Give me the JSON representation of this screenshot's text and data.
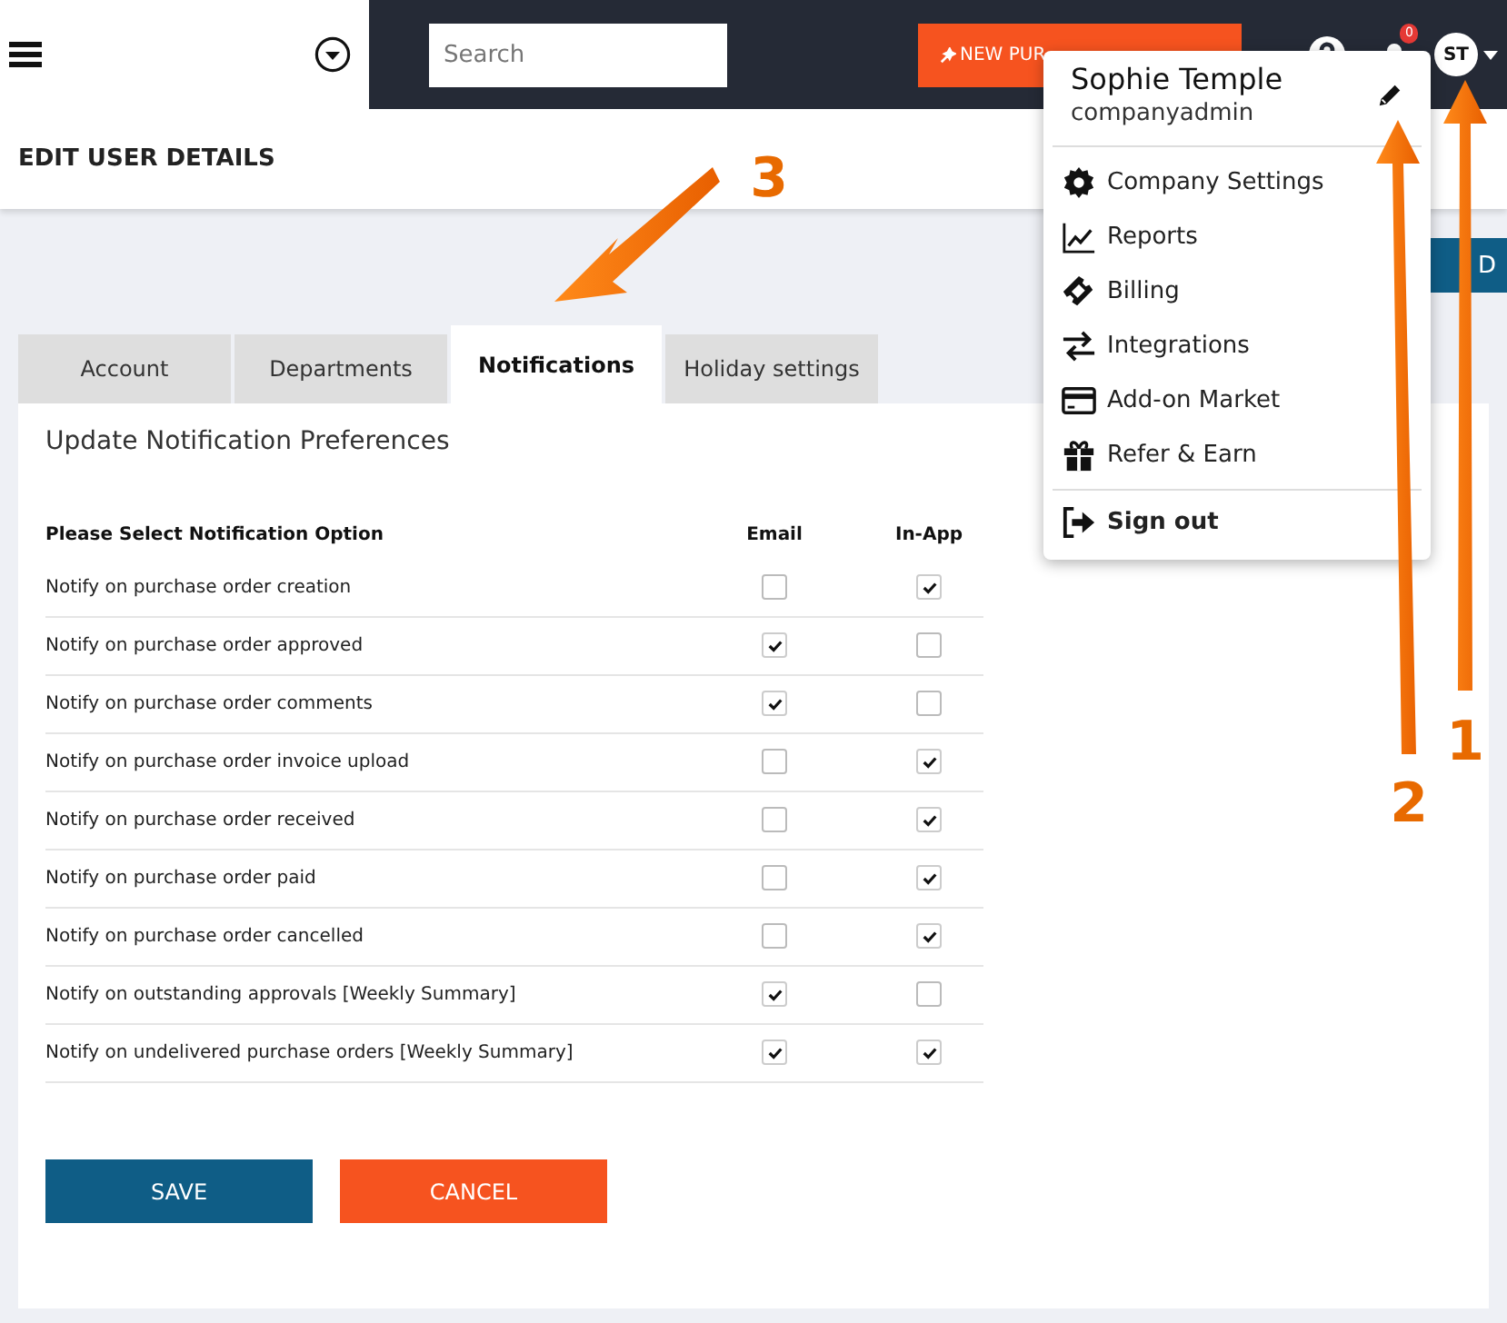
{
  "topbar": {
    "search": {
      "placeholder": "Search"
    },
    "new_button": "NEW PUR",
    "notification_badge": "0",
    "avatar": "ST"
  },
  "header": {
    "title": "EDIT USER DETAILS"
  },
  "side_button": "D",
  "tabs": [
    {
      "label": "Account",
      "selected": false
    },
    {
      "label": "Departments",
      "selected": false
    },
    {
      "label": "Notifications",
      "selected": true
    },
    {
      "label": "Holiday settings",
      "selected": false
    }
  ],
  "panel": {
    "title": "Update Notification Preferences",
    "columns": [
      "Please Select Notification Option",
      "Email",
      "In-App"
    ],
    "rows": [
      {
        "label": "Notify on purchase order creation",
        "email": false,
        "in_app": true
      },
      {
        "label": "Notify on purchase order approved",
        "email": true,
        "in_app": false
      },
      {
        "label": "Notify on purchase order comments",
        "email": true,
        "in_app": false
      },
      {
        "label": "Notify on purchase order invoice upload",
        "email": false,
        "in_app": true
      },
      {
        "label": "Notify on purchase order received",
        "email": false,
        "in_app": true
      },
      {
        "label": "Notify on purchase order paid",
        "email": false,
        "in_app": true
      },
      {
        "label": "Notify on purchase order cancelled",
        "email": false,
        "in_app": true
      },
      {
        "label": "Notify on outstanding approvals [Weekly Summary]",
        "email": true,
        "in_app": false
      },
      {
        "label": "Notify on undelivered purchase orders [Weekly Summary]",
        "email": true,
        "in_app": true
      }
    ],
    "buttons": [
      {
        "label": "SAVE",
        "kind": "primary"
      },
      {
        "label": "CANCEL",
        "kind": "danger"
      }
    ]
  },
  "user_menu": {
    "name": "Sophie Temple",
    "role": "companyadmin",
    "items": [
      {
        "label": "Company Settings",
        "kind": "gear"
      },
      {
        "label": "Reports",
        "kind": "chart"
      },
      {
        "label": "Billing",
        "kind": "ticket"
      },
      {
        "label": "Integrations",
        "kind": "arrows"
      },
      {
        "label": "Add-on Market",
        "kind": "card"
      },
      {
        "label": "Refer & Earn",
        "kind": "gift"
      }
    ],
    "sign_out": "Sign out"
  },
  "annotations": [
    "1",
    "2",
    "3"
  ]
}
